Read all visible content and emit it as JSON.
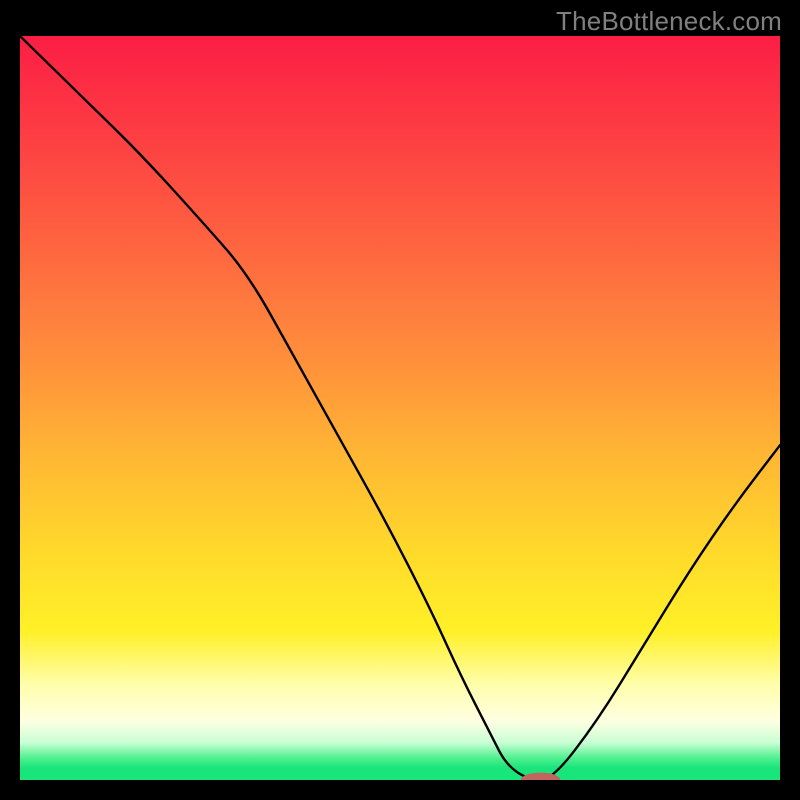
{
  "attribution": "TheBottleneck.com",
  "colors": {
    "frame": "#000000",
    "text": "#808080",
    "curve": "#000000",
    "marker": "#c1665e",
    "gradient_top": "#fc1e44",
    "gradient_mid": "#ffdb2a",
    "gradient_green": "#18e57a"
  },
  "chart_data": {
    "type": "line",
    "title": "",
    "xlabel": "",
    "ylabel": "",
    "xlim": [
      0,
      100
    ],
    "ylim": [
      0,
      100
    ],
    "grid": false,
    "legend": false,
    "x": [
      0,
      8,
      16,
      24,
      30,
      36,
      42,
      48,
      54,
      58,
      62,
      64,
      67,
      70,
      76,
      82,
      88,
      94,
      100
    ],
    "values": [
      100,
      92,
      84,
      75,
      68,
      57,
      46,
      35,
      23,
      14,
      6,
      2,
      0,
      0,
      8,
      18,
      28,
      37,
      45
    ],
    "marker": {
      "x": 68.5,
      "y": 0,
      "rx": 2.6,
      "ry": 1.0
    },
    "annotations": []
  }
}
